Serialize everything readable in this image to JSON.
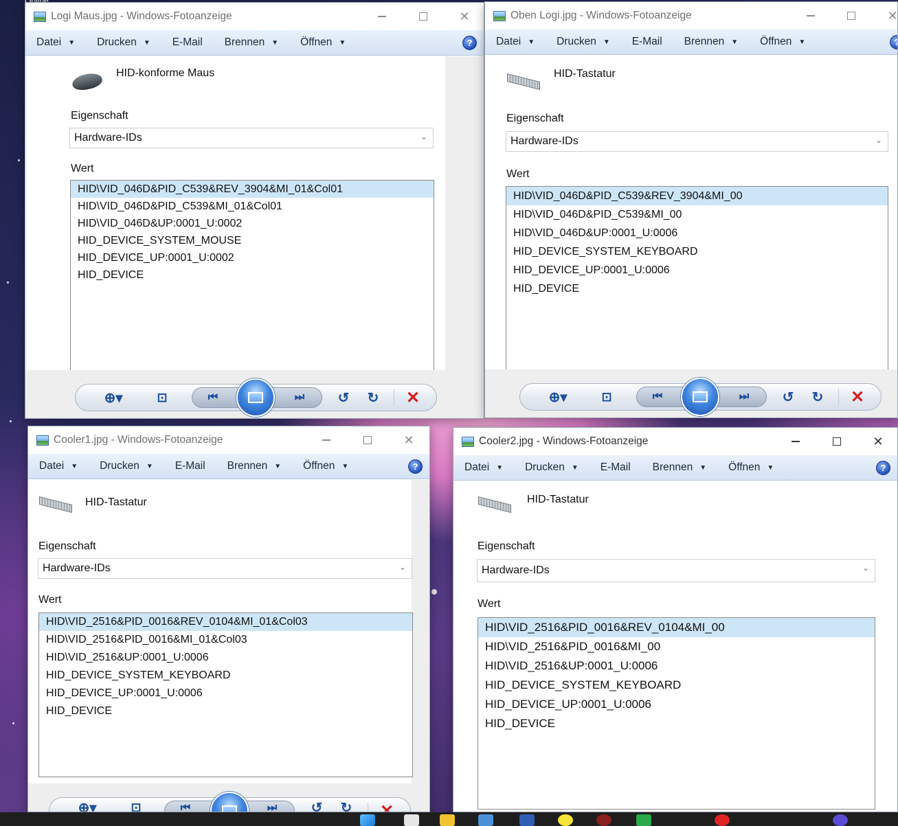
{
  "desktop": {
    "label": "Online"
  },
  "windows": [
    {
      "title": "Logi Maus.jpg - Windows-Fotoanzeige",
      "menu": [
        "Datei",
        "Drucken",
        "E-Mail",
        "Brennen",
        "Öffnen"
      ],
      "device_name": "HID-konforme Maus",
      "device_icon": "mouse-icon",
      "property_label": "Eigenschaft",
      "property_value": "Hardware-IDs",
      "value_label": "Wert",
      "values": [
        "HID\\VID_046D&PID_C539&REV_3904&MI_01&Col01",
        "HID\\VID_046D&PID_C539&MI_01&Col01",
        "HID\\VID_046D&UP:0001_U:0002",
        "HID_DEVICE_SYSTEM_MOUSE",
        "HID_DEVICE_UP:0001_U:0002",
        "HID_DEVICE"
      ]
    },
    {
      "title": "Oben Logi.jpg - Windows-Fotoanzeige",
      "menu": [
        "Datei",
        "Drucken",
        "E-Mail",
        "Brennen",
        "Öffnen"
      ],
      "device_name": "HID-Tastatur",
      "device_icon": "keyboard-icon",
      "property_label": "Eigenschaft",
      "property_value": "Hardware-IDs",
      "value_label": "Wert",
      "values": [
        "HID\\VID_046D&PID_C539&REV_3904&MI_00",
        "HID\\VID_046D&PID_C539&MI_00",
        "HID\\VID_046D&UP:0001_U:0006",
        "HID_DEVICE_SYSTEM_KEYBOARD",
        "HID_DEVICE_UP:0001_U:0006",
        "HID_DEVICE"
      ]
    },
    {
      "title": "Cooler1.jpg - Windows-Fotoanzeige",
      "menu": [
        "Datei",
        "Drucken",
        "E-Mail",
        "Brennen",
        "Öffnen"
      ],
      "device_name": "HID-Tastatur",
      "device_icon": "keyboard-icon",
      "property_label": "Eigenschaft",
      "property_value": "Hardware-IDs",
      "value_label": "Wert",
      "values": [
        "HID\\VID_2516&PID_0016&REV_0104&MI_01&Col03",
        "HID\\VID_2516&PID_0016&MI_01&Col03",
        "HID\\VID_2516&UP:0001_U:0006",
        "HID_DEVICE_SYSTEM_KEYBOARD",
        "HID_DEVICE_UP:0001_U:0006",
        "HID_DEVICE"
      ]
    },
    {
      "title": "Cooler2.jpg - Windows-Fotoanzeige",
      "menu": [
        "Datei",
        "Drucken",
        "E-Mail",
        "Brennen",
        "Öffnen"
      ],
      "device_name": "HID-Tastatur",
      "device_icon": "keyboard-icon",
      "property_label": "Eigenschaft",
      "property_value": "Hardware-IDs",
      "value_label": "Wert",
      "values": [
        "HID\\VID_2516&PID_0016&REV_0104&MI_00",
        "HID\\VID_2516&PID_0016&MI_00",
        "HID\\VID_2516&UP:0001_U:0006",
        "HID_DEVICE_SYSTEM_KEYBOARD",
        "HID_DEVICE_UP:0001_U:0006",
        "HID_DEVICE"
      ]
    }
  ],
  "colors": {
    "selection": "#cde6f7",
    "menubar": "#d4e2f4",
    "accent": "#1d4f9c",
    "delete": "#d42020"
  }
}
